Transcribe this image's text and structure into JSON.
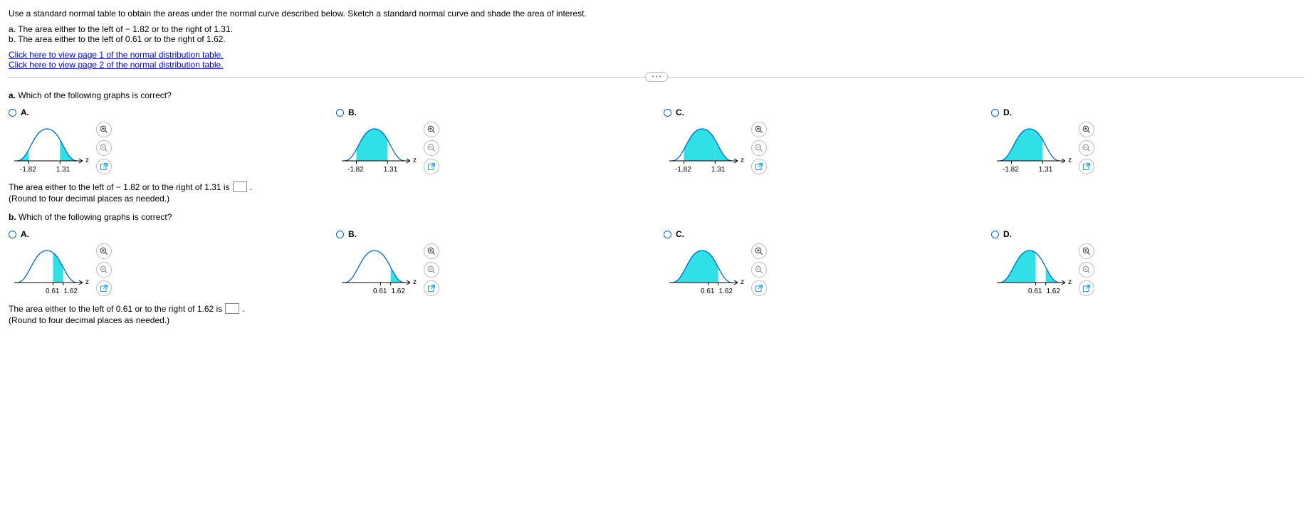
{
  "intro": "Use a standard normal table to obtain the areas under the normal curve described below. Sketch a standard normal curve and shade the area of interest.",
  "parts": {
    "a": "a. The area either to the left of − 1.82 or to the right of 1.31.",
    "b": "b. The area either to the left of 0.61 or to the right of 1.62."
  },
  "links": {
    "page1": "Click here to view page 1 of the normal distribution table.",
    "page2": "Click here to view page 2 of the normal distribution table."
  },
  "pill": "• • •",
  "qA": {
    "prompt_prefix": "a.",
    "prompt": " Which of the following graphs is correct?",
    "ticks": {
      "left": "-1.82",
      "right": "1.31"
    },
    "answer_prefix": "The area either to the left of − 1.82 or to the right of 1.31 is ",
    "answer_suffix": ".",
    "round": "(Round to four decimal places as needed.)"
  },
  "qB": {
    "prompt_prefix": "b.",
    "prompt": " Which of the following graphs is correct?",
    "ticks": {
      "left": "0.61",
      "right": "1.62"
    },
    "answer_prefix": "The area either to the left of 0.61 or to the right of 1.62 is ",
    "answer_suffix": ".",
    "round": "(Round to four decimal places as needed.)"
  },
  "options": {
    "A": "A.",
    "B": "B.",
    "C": "C.",
    "D": "D."
  },
  "axis": "z"
}
